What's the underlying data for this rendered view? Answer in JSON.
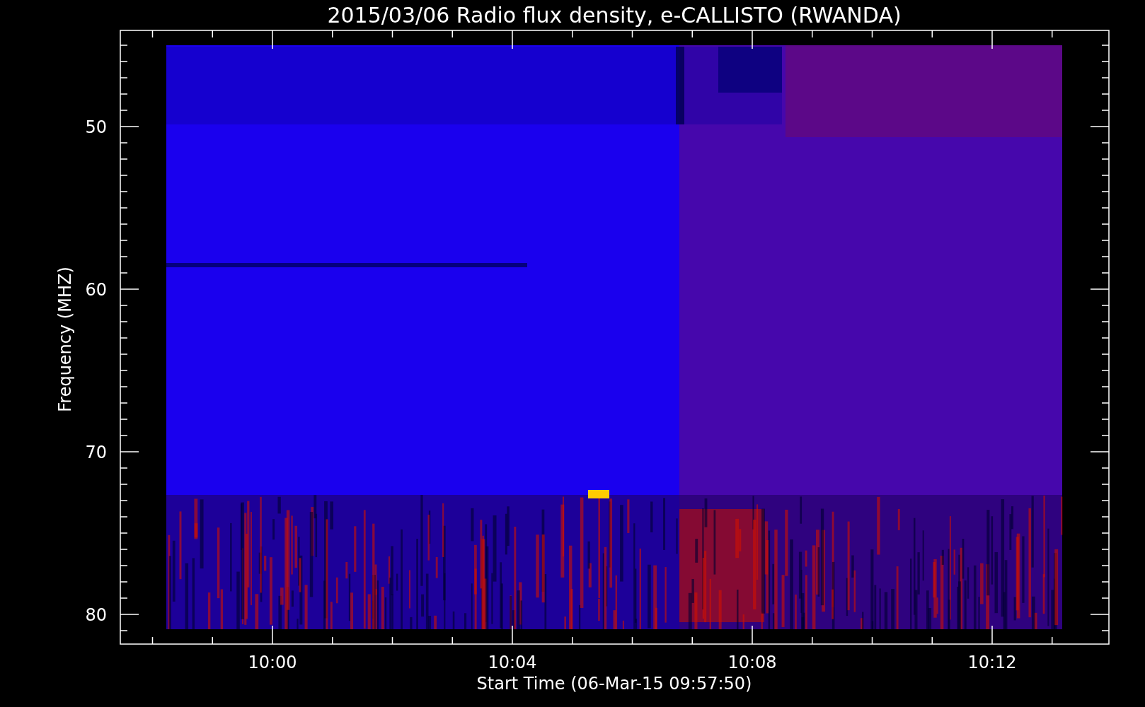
{
  "plot": {
    "title": "2015/03/06  Radio flux density, e-CALLISTO (RWANDA)",
    "y_axis": {
      "label": "Frequency (MHZ)",
      "ticks": [
        "50",
        "60",
        "70",
        "80"
      ]
    },
    "x_axis": {
      "label": "Start Time (06-Mar-15 09:57:50)",
      "ticks": [
        "10:00",
        "10:04",
        "10:08",
        "10:12"
      ]
    }
  }
}
